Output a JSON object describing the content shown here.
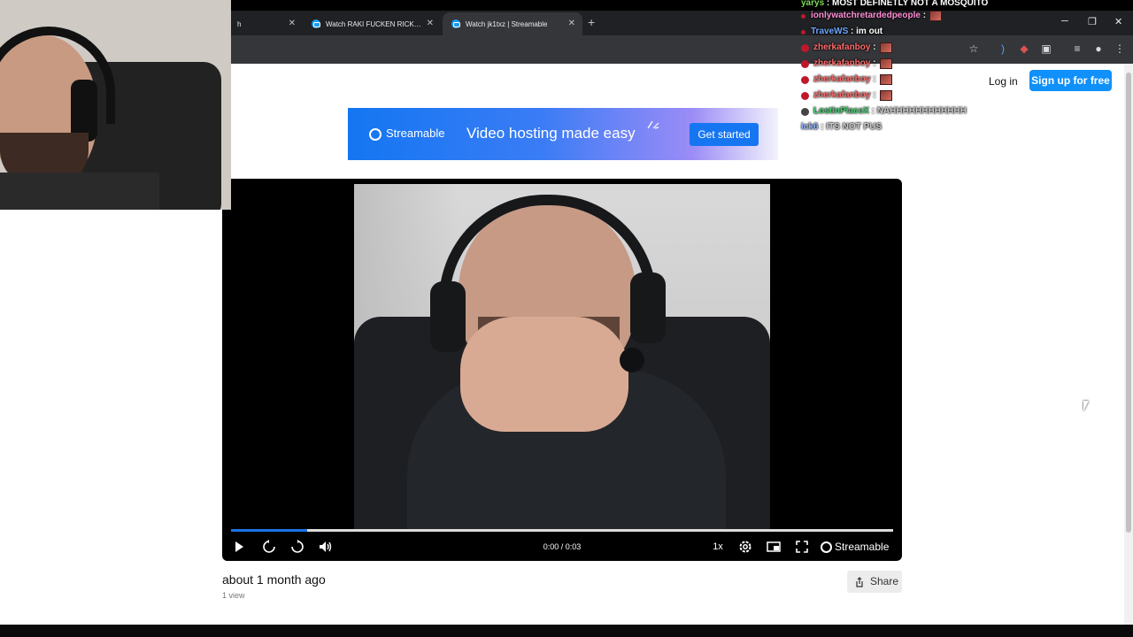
{
  "browser": {
    "tabs": [
      {
        "title": "h",
        "close": "✕"
      },
      {
        "title": "Watch RAKI FUCKEN RICKS | St",
        "close": "✕"
      },
      {
        "title": "Watch jk1txz | Streamable",
        "close": "✕"
      }
    ],
    "new_tab": "+",
    "window_controls": {
      "minimize": "─",
      "restore": "❐",
      "close": "✕"
    },
    "toolbar_icons": [
      "star-icon",
      "extension-audio-icon",
      "extension-icon",
      "puzzle-icon",
      "media-icon",
      "profile-icon",
      "menu-icon"
    ]
  },
  "header": {
    "login": "Log in",
    "signup": "Sign up for free"
  },
  "banner": {
    "logo": "Streamable",
    "headline": "Video hosting made easy",
    "cta": "Get started"
  },
  "player": {
    "time": "0:00 / 0:03",
    "speed": "1x",
    "brand": "Streamable",
    "progress": 0.115,
    "controls": [
      "play-icon",
      "rewind-icon",
      "forward-icon",
      "volume-icon",
      "settings-icon",
      "pip-icon",
      "fullscreen-icon"
    ]
  },
  "meta": {
    "date": "about 1 month ago",
    "views": "1 view",
    "share": "Share"
  },
  "chat": [
    {
      "user": "yarys",
      "text": "MOST DEFINETLY NOT A MOSQUITO",
      "color": "#7ed957"
    },
    {
      "user": "ionlywatchretardedpeople",
      "text": "",
      "color": "#ff8ed6",
      "emote": true
    },
    {
      "user": "TraveWS",
      "text": "im out",
      "color": "#6fa8ff"
    },
    {
      "user": "zherkafanboy",
      "text": "",
      "color": "#ff6b6b",
      "emote": true
    },
    {
      "user": "zherkafanboy",
      "text": "",
      "color": "#ff6b6b",
      "emote": true
    },
    {
      "user": "zherkafanboy",
      "text": "",
      "color": "#ff6b6b",
      "emote": true
    },
    {
      "user": "zherkafanboy",
      "text": "",
      "color": "#ff6b6b",
      "emote": true
    },
    {
      "user": "LostInPlaceX",
      "text": "NAHHHHHHHHHHHH",
      "color": "#3fd16f"
    },
    {
      "user": "ick6",
      "text": "ITS NOT PUS",
      "color": "#8fb4ff"
    }
  ],
  "colors": {
    "accent": "#0f90fa",
    "progress": "#1a73e8",
    "chrome_dark": "#202124"
  }
}
